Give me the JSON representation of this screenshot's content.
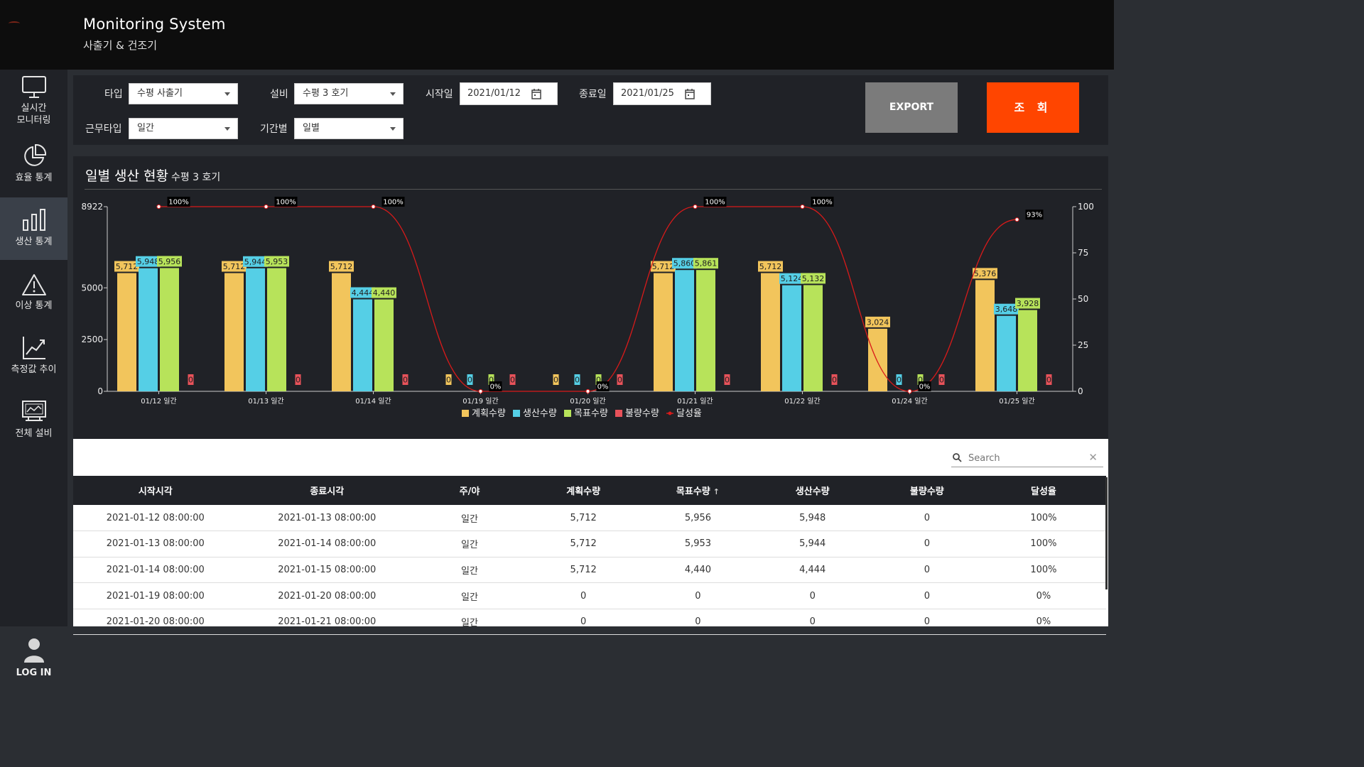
{
  "app": {
    "title": "Monitoring System",
    "subtitle": "사출기 & 건조기"
  },
  "sidebar": {
    "items": [
      {
        "label1": "실시간",
        "label2": "모니터링",
        "icon": "monitor-icon"
      },
      {
        "label1": "효율 통계",
        "icon": "pie-chart-icon"
      },
      {
        "label1": "생산 통계",
        "icon": "bar-chart-icon",
        "active": true
      },
      {
        "label1": "이상 통계",
        "icon": "warning-icon"
      },
      {
        "label1": "측정값 추이",
        "icon": "line-chart-icon"
      },
      {
        "label1": "전체 설비",
        "icon": "equipment-icon"
      }
    ],
    "login_label": "LOG IN"
  },
  "filters": {
    "type_label": "타입",
    "type_value": "수평 사출기",
    "equip_label": "설비",
    "equip_value": "수평 3 호기",
    "start_label": "시작일",
    "start_value": "2021/01/12",
    "end_label": "종료일",
    "end_value": "2021/01/25",
    "shift_label": "근무타입",
    "shift_value": "일간",
    "period_label": "기간별",
    "period_value": "일별",
    "export_label": "EXPORT",
    "search_label": "조 회"
  },
  "chart_panel": {
    "title": "일별 생산 현황",
    "subtitle": "수평 3 호기"
  },
  "chart_data": {
    "type": "bar",
    "categories": [
      "01/12 일간",
      "01/13 일간",
      "01/14 일간",
      "01/19 일간",
      "01/20 일간",
      "01/21 일간",
      "01/22 일간",
      "01/24 일간",
      "01/25 일간"
    ],
    "series": [
      {
        "name": "계획수량",
        "color": "#f2c55c",
        "values": [
          5712,
          5712,
          5712,
          0,
          0,
          5712,
          5712,
          3024,
          5376
        ]
      },
      {
        "name": "생산수량",
        "color": "#55cfe6",
        "values": [
          5948,
          5944,
          4444,
          0,
          0,
          5860,
          5124,
          0,
          3648
        ]
      },
      {
        "name": "목표수량",
        "color": "#b7e35a",
        "values": [
          5956,
          5953,
          4440,
          0,
          0,
          5861,
          5132,
          0,
          3928
        ]
      },
      {
        "name": "불량수량",
        "color": "#e8525a",
        "values": [
          0,
          0,
          0,
          0,
          0,
          0,
          0,
          0,
          0
        ]
      }
    ],
    "line_series": {
      "name": "달성율",
      "color": "#d91a1a",
      "values": [
        100,
        100,
        100,
        0,
        0,
        100,
        100,
        0,
        93
      ]
    },
    "y_left": {
      "ticks": [
        0,
        2500,
        5000,
        8922
      ],
      "max": 8922
    },
    "y_right": {
      "ticks": [
        0,
        25,
        50,
        75,
        100
      ],
      "max": 100
    },
    "legend_position": "bottom-center"
  },
  "table": {
    "search_placeholder": "Search",
    "columns": [
      "시작시각",
      "종료시각",
      "주/야",
      "계획수량",
      "목표수량",
      "생산수량",
      "불량수량",
      "달성율"
    ],
    "sort_indicator": "↑",
    "rows": [
      [
        "2021-01-12 08:00:00",
        "2021-01-13 08:00:00",
        "일간",
        "5,712",
        "5,956",
        "5,948",
        "0",
        "100%"
      ],
      [
        "2021-01-13 08:00:00",
        "2021-01-14 08:00:00",
        "일간",
        "5,712",
        "5,953",
        "5,944",
        "0",
        "100%"
      ],
      [
        "2021-01-14 08:00:00",
        "2021-01-15 08:00:00",
        "일간",
        "5,712",
        "4,440",
        "4,444",
        "0",
        "100%"
      ],
      [
        "2021-01-19 08:00:00",
        "2021-01-20 08:00:00",
        "일간",
        "0",
        "0",
        "0",
        "0",
        "0%"
      ],
      [
        "2021-01-20 08:00:00",
        "2021-01-21 08:00:00",
        "일간",
        "0",
        "0",
        "0",
        "0",
        "0%"
      ]
    ]
  }
}
